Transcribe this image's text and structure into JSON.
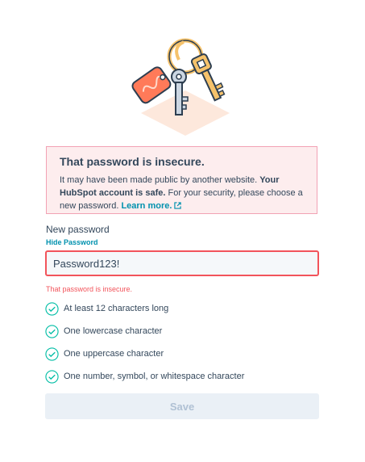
{
  "alert": {
    "title": "That password is insecure.",
    "body_1": "It may have been made public by another website. ",
    "body_bold": "Your HubSpot account is safe.",
    "body_2": " For your security, please choose a new password. ",
    "link_label": "Learn more."
  },
  "form": {
    "label": "New password",
    "toggle_label": "Hide Password",
    "password_value": "Password123!",
    "error": "That password is insecure."
  },
  "requirements": [
    {
      "label": "At least 12 characters long",
      "met": true
    },
    {
      "label": "One lowercase character",
      "met": true
    },
    {
      "label": "One uppercase character",
      "met": true
    },
    {
      "label": "One number, symbol, or whitespace character",
      "met": true
    }
  ],
  "save_label": "Save",
  "colors": {
    "accent": "#0091ae",
    "error": "#f2545b",
    "success": "#00bda5",
    "alert_bg": "#fdedee"
  }
}
